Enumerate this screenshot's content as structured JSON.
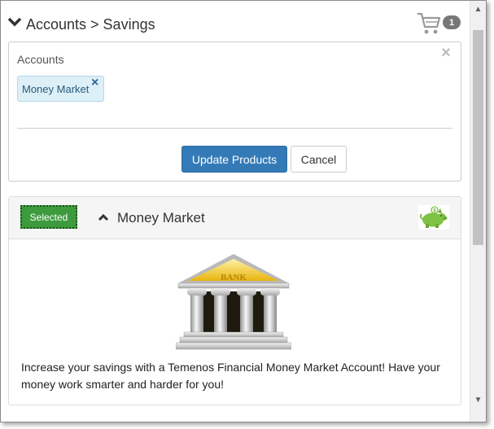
{
  "header": {
    "breadcrumb": "Accounts > Savings",
    "cart_count": "1"
  },
  "accounts_panel": {
    "label": "Accounts",
    "tags": [
      {
        "label": "Money Market"
      }
    ],
    "update_label": "Update Products",
    "cancel_label": "Cancel"
  },
  "product": {
    "status": "Selected",
    "title": "Money Market",
    "bank_sign": "BANK",
    "description": "Increase your savings with a Temenos Financial Money Market Account! Have your money work smarter and harder for you!"
  },
  "icons": {
    "header_toggle": "chevron-down-icon",
    "cart": "cart-icon",
    "panel_close": "close-icon",
    "tag_remove": "close-icon",
    "collapse": "chevron-up-icon",
    "product_icon": "piggy-bank-icon",
    "product_image": "bank-building-icon"
  },
  "colors": {
    "primary": "#337ab7",
    "selected": "#3d9b3d",
    "tag_bg": "#ddeff7",
    "tag_remove": "#2a6496",
    "piggy": "#7ec243",
    "bank_roof": "#f0c419"
  }
}
